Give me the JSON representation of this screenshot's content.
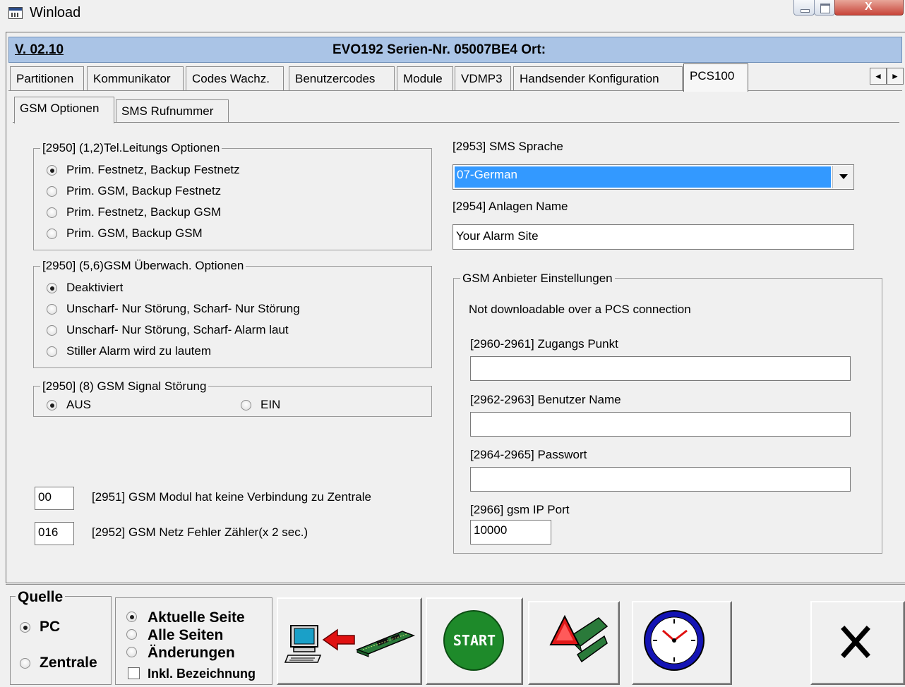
{
  "window": {
    "title": "Winload",
    "close_label": "X"
  },
  "header": {
    "version": "V. 02.10",
    "panel_info": "EVO192  Serien-Nr. 05007BE4 Ort:"
  },
  "tabs": [
    "Partitionen",
    "Kommunikator",
    "Codes Wachz.",
    "Benutzercodes",
    "Module",
    "VDMP3",
    "Handsender Konfiguration",
    "PCS100"
  ],
  "active_tab": "PCS100",
  "scroll_arrows": {
    "left": "◄",
    "right": "►"
  },
  "subtabs": [
    "GSM Optionen",
    "SMS Rufnummer"
  ],
  "active_subtab": "GSM Optionen",
  "tel_options": {
    "legend": "[2950]  (1,2)Tel.Leitungs Optionen",
    "options": [
      "Prim. Festnetz, Backup Festnetz",
      "Prim. GSM, Backup Festnetz",
      "Prim. Festnetz, Backup GSM",
      "Prim. GSM, Backup GSM"
    ],
    "selected": 0
  },
  "gsm_watch": {
    "legend": "[2950]  (5,6)GSM Überwach. Optionen",
    "options": [
      "Deaktiviert",
      "Unscharf- Nur Störung, Scharf- Nur Störung",
      "Unscharf- Nur Störung, Scharf- Alarm laut",
      "Stiller Alarm wird zu lautem"
    ],
    "selected": 0
  },
  "gsm_signal": {
    "legend": "[2950] (8)  GSM Signal Störung",
    "options": [
      "AUS",
      "EIN"
    ],
    "selected": 0
  },
  "no_connection": {
    "value": "00",
    "label": "[2951] GSM Modul hat keine Verbindung zu Zentrale"
  },
  "net_error": {
    "value": "016",
    "label": "[2952] GSM Netz Fehler Zähler(x 2 sec.)"
  },
  "sms_language": {
    "label": "[2953] SMS Sprache",
    "value": "07-German"
  },
  "site_name": {
    "label": "[2954] Anlagen Name",
    "value": "Your Alarm Site"
  },
  "provider": {
    "legend": "GSM Anbieter Einstellungen",
    "note": "Not downloadable over a PCS connection",
    "access_point_label": "[2960-2961] Zugangs Punkt",
    "access_point_value": "",
    "username_label": "[2962-2963] Benutzer Name",
    "username_value": "",
    "password_label": "[2964-2965] Passwort",
    "password_value": "",
    "ip_port_label": "[2966] gsm IP Port",
    "ip_port_value": "10000"
  },
  "source": {
    "legend": "Quelle",
    "options": [
      "PC",
      "Zentrale"
    ],
    "selected": 0
  },
  "pages": {
    "options": [
      "Aktuelle Seite",
      "Alle Seiten",
      "Änderungen"
    ],
    "selected": 0,
    "include_label": "Inkl. Bezeichnung",
    "include_checked": false
  },
  "actions": {
    "start_label": "START"
  },
  "colors": {
    "header_bg": "#aac4e6",
    "selection": "#3399ff",
    "start_green": "#1e8a2a",
    "arrow_red": "#e01010"
  }
}
